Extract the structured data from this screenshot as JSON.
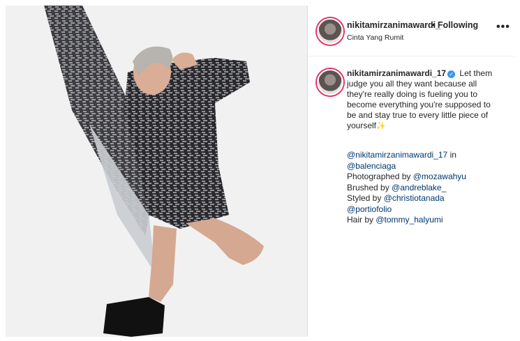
{
  "post": {
    "username": "nikitamirzanimawardi_",
    "separator": "•",
    "following_label": "Following",
    "location": "Cinta Yang Rumit",
    "more_icon": "•••"
  },
  "caption": {
    "username": "nikitamirzanimawardi_17",
    "verified_icon": "verified-badge-icon",
    "verified_glyph": "✓",
    "text": "Let them judge you all they want because all they're really doing is fueling you to become everything you're supposed to be and stay true to every little piece of yourself",
    "emoji": "✨"
  },
  "credits": {
    "line1_mention": "@nikitamirzanimawardi_17",
    "line1_suffix": " in",
    "line2_mention": "@balenciaga",
    "line3_prefix": "Photographed by ",
    "line3_mention": "@mozawahyu",
    "line4_prefix": "Brushed by ",
    "line4_mention": "@andreblake_",
    "line5_prefix": "Styled by ",
    "line5_mention": "@christiotanada",
    "line6_mention": "@portiofolio",
    "line7_prefix": "Hair by ",
    "line7_mention": "@tommy_halyumi"
  },
  "colors": {
    "verified": "#3897f0",
    "mention": "#00376b",
    "story_ring": "#e1306c"
  }
}
